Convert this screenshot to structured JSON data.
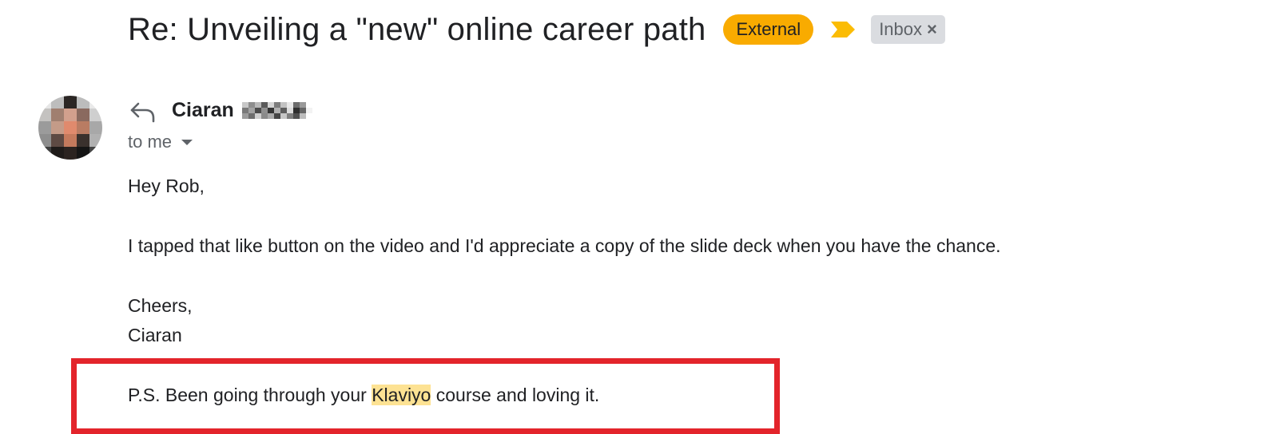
{
  "email": {
    "subject": "Re: Unveiling a \"new\" online career path",
    "labels": {
      "external": "External",
      "inbox": "Inbox",
      "inbox_remove": "×"
    },
    "sender": {
      "name": "Ciaran"
    },
    "recipient_line": "to me",
    "body": {
      "greeting": "Hey Rob,",
      "message": "I tapped that like button on the video and I'd appreciate a copy of the slide deck when you have the chance.",
      "signoff": "Cheers,",
      "signature": "Ciaran",
      "ps_before": "P.S. Been going through your ",
      "ps_highlight": "Klaviyo",
      "ps_after": " course and loving it."
    }
  },
  "colors": {
    "label_external": "#f9ab00",
    "importance_marker": "#fbbc04",
    "label_inbox": "#dadce0",
    "search_highlight": "#fde293",
    "callout_box": "#e3242b"
  },
  "icons": {
    "importance": "importance-marker-icon",
    "reply": "reply-arrow-icon",
    "recipient_details": "caret-down-icon"
  }
}
